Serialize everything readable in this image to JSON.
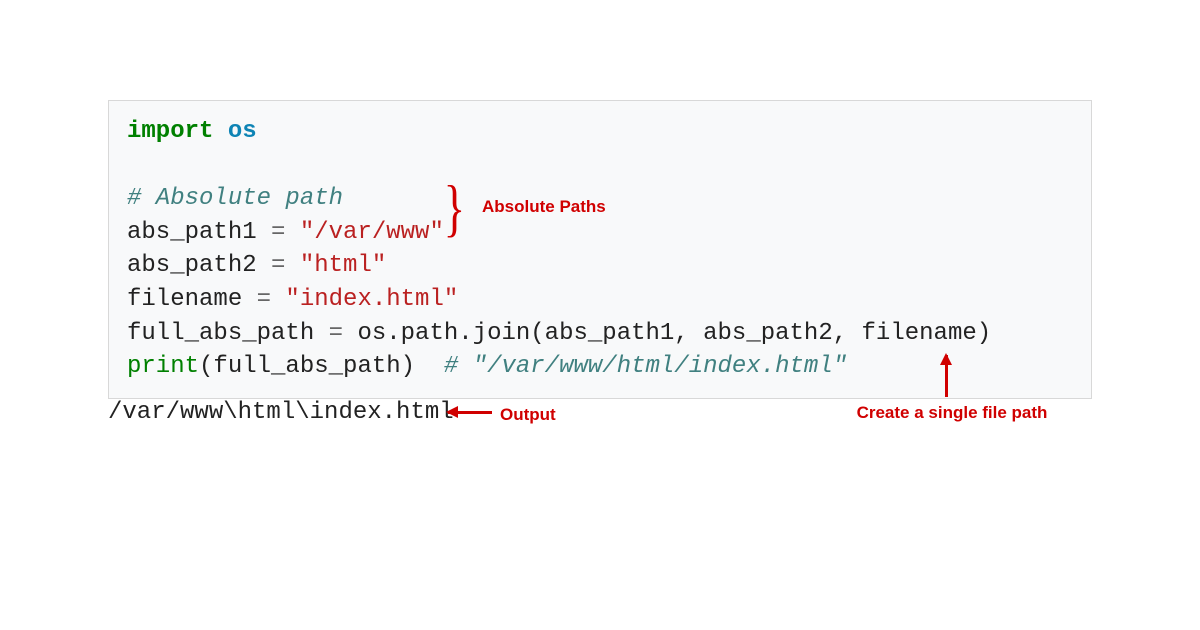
{
  "code": {
    "line1": {
      "keyword": "import",
      "module": "os"
    },
    "line3": {
      "comment": "# Absolute path"
    },
    "line4": {
      "var": "abs_path1 ",
      "eq": "=",
      "str": " \"/var/www\""
    },
    "line5": {
      "var": "abs_path2 ",
      "eq": "=",
      "str": " \"html\""
    },
    "line6": {
      "var": "filename ",
      "eq": "=",
      "str": " \"index.html\""
    },
    "line7": {
      "var": "full_abs_path ",
      "eq": "=",
      "call": " os.path.join(abs_path1, abs_path2, filename)"
    },
    "line8": {
      "func": "print",
      "args": "(full_abs_path)  ",
      "comment": "# \"/var/www/html/index.html\""
    }
  },
  "output": "/var/www\\html\\index.html",
  "annotations": {
    "absolute_paths": "Absolute Paths",
    "output_label": "Output",
    "single_file_path": "Create a single file path"
  }
}
